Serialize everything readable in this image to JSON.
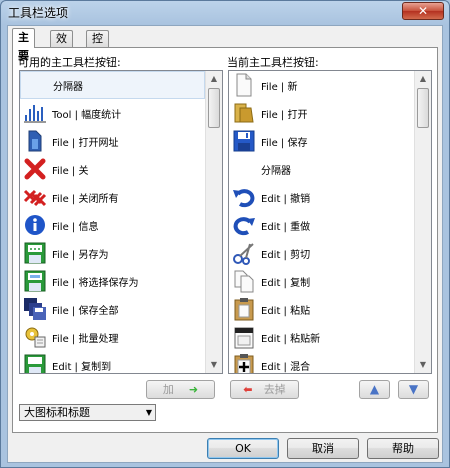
{
  "window": {
    "title": "工具栏选项",
    "close_label": "✕"
  },
  "tabs": [
    {
      "label": "主要",
      "active": true
    },
    {
      "label": "效果",
      "active": false
    },
    {
      "label": "控制",
      "active": false
    }
  ],
  "available": {
    "label": "可用的主工具栏按钮:",
    "items": [
      {
        "label": "分隔器",
        "icon": "separator",
        "selected": true
      },
      {
        "label": "Tool | 幅度统计",
        "icon": "amplitude-stats-icon"
      },
      {
        "label": "File | 打开网址",
        "icon": "open-url-icon"
      },
      {
        "label": "File | 关",
        "icon": "close-x-icon"
      },
      {
        "label": "File | 关闭所有",
        "icon": "close-all-icon"
      },
      {
        "label": "File | 信息",
        "icon": "info-icon"
      },
      {
        "label": "File | 另存为",
        "icon": "save-as-icon"
      },
      {
        "label": "File | 将选择保存为",
        "icon": "save-selection-icon"
      },
      {
        "label": "File | 保存全部",
        "icon": "save-all-icon"
      },
      {
        "label": "File | 批量处理",
        "icon": "batch-process-icon"
      },
      {
        "label": "Edit | 复制到",
        "icon": "copy-to-icon"
      }
    ]
  },
  "current": {
    "label": "当前主工具栏按钮:",
    "items": [
      {
        "label": "File | 新",
        "icon": "new-file-icon"
      },
      {
        "label": "File | 打开",
        "icon": "open-folder-icon"
      },
      {
        "label": "File | 保存",
        "icon": "save-icon"
      },
      {
        "label": "分隔器",
        "icon": "separator"
      },
      {
        "label": "Edit | 撤销",
        "icon": "undo-icon"
      },
      {
        "label": "Edit | 重做",
        "icon": "redo-icon"
      },
      {
        "label": "Edit | 剪切",
        "icon": "cut-icon"
      },
      {
        "label": "Edit | 复制",
        "icon": "copy-icon"
      },
      {
        "label": "Edit | 粘贴",
        "icon": "paste-icon"
      },
      {
        "label": "Edit | 粘贴新",
        "icon": "paste-new-icon"
      },
      {
        "label": "Edit | 混合",
        "icon": "mix-icon"
      }
    ]
  },
  "buttons": {
    "add": "加",
    "remove": "去掉",
    "ok": "OK",
    "cancel": "取消",
    "help": "帮助"
  },
  "icon_size_select": {
    "value": "大图标和标题"
  },
  "colors": {
    "accent": "#3c7fb1",
    "window_frame": "#a9c3df"
  }
}
